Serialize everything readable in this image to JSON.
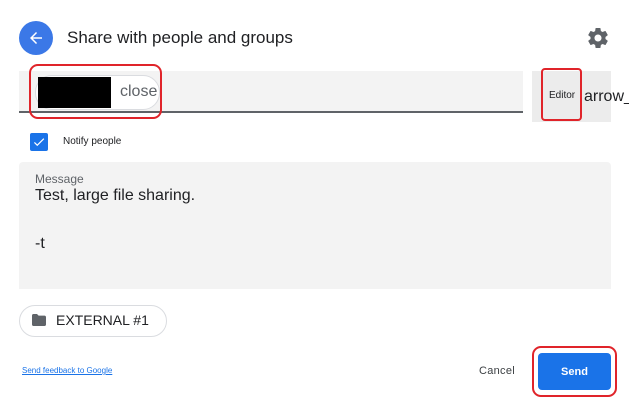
{
  "header": {
    "title": "Share with people and groups",
    "back_icon": "arrow-back-icon",
    "settings_icon": "gear-icon"
  },
  "recipient": {
    "chip_close_label": "close"
  },
  "role": {
    "label": "Editor",
    "arrow_text": "arrow_drop_down"
  },
  "notify": {
    "checked": true,
    "label": "Notify people"
  },
  "message": {
    "label": "Message",
    "line1": "Test, large file sharing.",
    "line3": "-t"
  },
  "external_chip": {
    "label": "EXTERNAL #1",
    "icon": "folder-icon"
  },
  "footer": {
    "feedback_link": "Send feedback to Google",
    "cancel_label": "Cancel",
    "send_label": "Send"
  },
  "colors": {
    "accent": "#1a73e8",
    "back_button": "#3b78e7",
    "highlight_outline": "#e0242a"
  }
}
